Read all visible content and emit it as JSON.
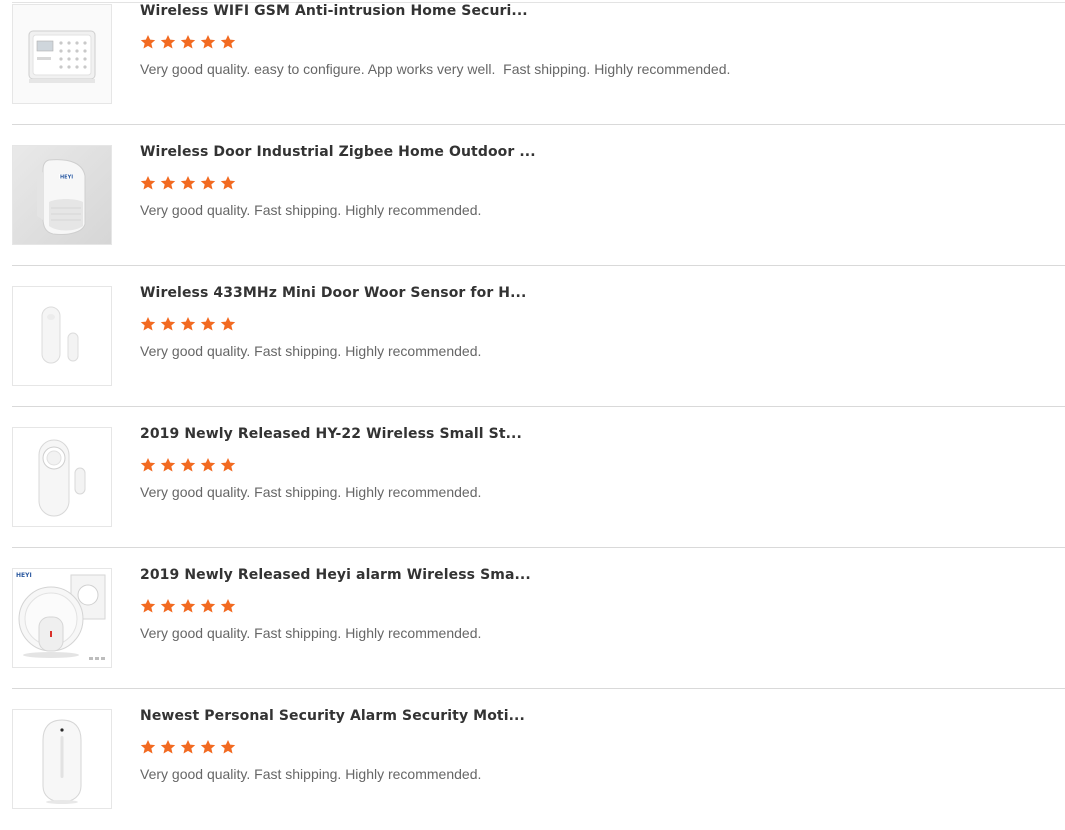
{
  "colors": {
    "star": "#f26a21",
    "title": "#333333",
    "text": "#666666",
    "divider": "#d9d9d9"
  },
  "reviews": [
    {
      "product_title": "Wireless WIFI GSM Anti-intrusion Home Securi...",
      "rating": 5,
      "max_rating": 5,
      "text": "Very good quality. easy to configure. App works very well.  Fast shipping. Highly recommended.",
      "thumbnail_icon": "alarm-panel-icon"
    },
    {
      "product_title": "Wireless Door Industrial Zigbee Home Outdoor ...",
      "rating": 5,
      "max_rating": 5,
      "text": "Very good quality. Fast shipping. Highly recommended.",
      "thumbnail_icon": "motion-sensor-icon",
      "thumbnail_logo": "HEYI"
    },
    {
      "product_title": "Wireless 433MHz Mini Door Woor Sensor for H...",
      "rating": 5,
      "max_rating": 5,
      "text": "Very good quality. Fast shipping. Highly recommended.",
      "thumbnail_icon": "door-sensor-icon"
    },
    {
      "product_title": "2019 Newly Released HY-22 Wireless Small St...",
      "rating": 5,
      "max_rating": 5,
      "text": "Very good quality. Fast shipping. Highly recommended.",
      "thumbnail_icon": "door-alarm-icon"
    },
    {
      "product_title": "2019 Newly Released Heyi alarm Wireless Sma...",
      "rating": 5,
      "max_rating": 5,
      "text": "Very good quality. Fast shipping. Highly recommended.",
      "thumbnail_icon": "round-alarm-icon",
      "thumbnail_logo": "HEYI"
    },
    {
      "product_title": "Newest Personal Security Alarm Security Moti...",
      "rating": 5,
      "max_rating": 5,
      "text": "Very good quality. Fast shipping. Highly recommended.",
      "thumbnail_icon": "motion-detector-icon"
    }
  ]
}
